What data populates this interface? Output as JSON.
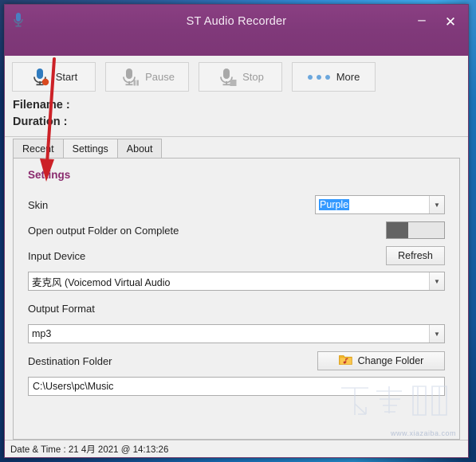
{
  "window": {
    "title": "ST Audio Recorder",
    "icon": "microphone-icon",
    "minimize_label": "–",
    "close_label": "✕",
    "accent_color": "#7d3676",
    "title_text_color": "#f4eaf3"
  },
  "toolbar": {
    "buttons": [
      {
        "label": "Start",
        "icon": "microphone-record-icon",
        "enabled": true
      },
      {
        "label": "Pause",
        "icon": "microphone-pause-icon",
        "enabled": false
      },
      {
        "label": "Stop",
        "icon": "microphone-stop-icon",
        "enabled": false
      },
      {
        "label": "More",
        "icon": "three-dots-icon",
        "enabled": true
      }
    ],
    "filename_label": "Filename :",
    "filename_value": "",
    "duration_label": "Duration :",
    "duration_value": ""
  },
  "tabs": [
    {
      "label": "Recent",
      "active": false
    },
    {
      "label": "Settings",
      "active": true
    },
    {
      "label": "About",
      "active": false
    }
  ],
  "settings": {
    "heading": "Settings",
    "heading_color": "#8a2b6e",
    "skin": {
      "label": "Skin",
      "value": "Purple",
      "selected": true,
      "dropdown_icon": "chevron-down-icon"
    },
    "open_output_folder": {
      "label": "Open output Folder on Complete",
      "state": "off"
    },
    "input_device": {
      "label": "Input Device",
      "refresh_label": "Refresh",
      "value": "麦克风 (Voicemod Virtual Audio",
      "dropdown_icon": "chevron-down-icon"
    },
    "output_format": {
      "label": "Output Format",
      "value": "mp3",
      "dropdown_icon": "chevron-down-icon"
    },
    "destination_folder": {
      "label": "Destination Folder",
      "change_label": "Change Folder",
      "change_icon": "music-folder-icon",
      "value": "C:\\Users\\pc\\Music"
    }
  },
  "statusbar": {
    "text": "Date & Time : 21 4月 2021 @ 14:13:26"
  },
  "watermark": {
    "logo_text": "下载吧",
    "url_text": "www.xiazaiba.com"
  }
}
